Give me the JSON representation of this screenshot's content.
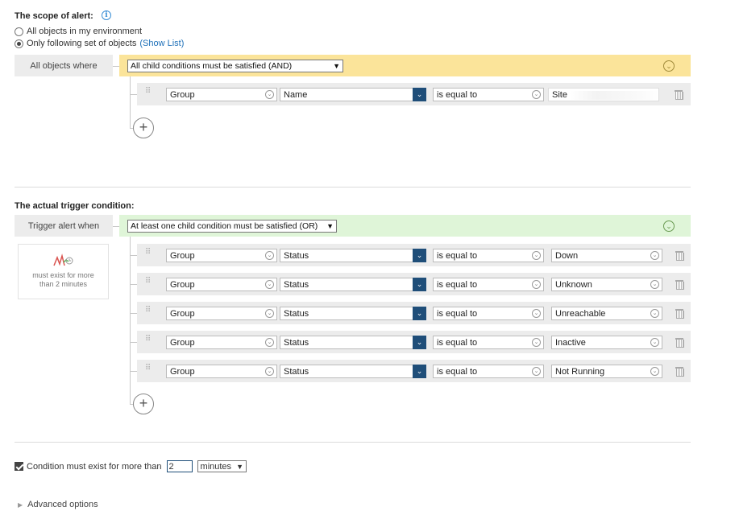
{
  "scope": {
    "title": "The scope of alert:",
    "options": [
      "All objects in my environment",
      "Only following set of objects"
    ],
    "selected_index": 1,
    "show_list": "(Show List)",
    "where_label": "All objects where",
    "logic_select": "All child conditions must be satisfied (AND)",
    "condition": {
      "object_type": "Group",
      "property": "Name",
      "operator": "is equal to",
      "value": "Site"
    }
  },
  "trigger": {
    "title": "The actual trigger condition:",
    "when_label": "Trigger alert when",
    "logic_select": "At least one child condition must be satisfied (OR)",
    "side_card_text": "must exist for more than 2 minutes",
    "rows": [
      {
        "object_type": "Group",
        "property": "Status",
        "operator": "is equal to",
        "value": "Down"
      },
      {
        "object_type": "Group",
        "property": "Status",
        "operator": "is equal to",
        "value": "Unknown"
      },
      {
        "object_type": "Group",
        "property": "Status",
        "operator": "is equal to",
        "value": "Unreachable"
      },
      {
        "object_type": "Group",
        "property": "Status",
        "operator": "is equal to",
        "value": "Inactive"
      },
      {
        "object_type": "Group",
        "property": "Status",
        "operator": "is equal to",
        "value": "Not Running"
      }
    ]
  },
  "duration": {
    "checkbox_label": "Condition must exist for more than",
    "checked": true,
    "value": "2",
    "unit": "minutes"
  },
  "advanced": {
    "label": "Advanced options"
  },
  "icons": {
    "info": "info-icon",
    "collapse": "chevron-down-circle-icon",
    "grip": "drag-handle-icon",
    "delete": "trash-icon",
    "add": "plus-circle-icon",
    "expand": "chevron-right-icon"
  },
  "colors": {
    "and_bar": "#fbe49a",
    "or_bar": "#dff5d8",
    "dropdown_accent": "#1f4e79",
    "link": "#1c6fb8"
  }
}
